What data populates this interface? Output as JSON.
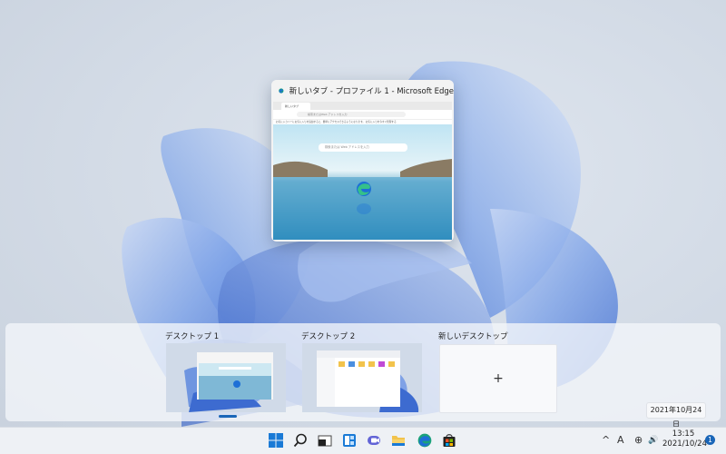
{
  "window": {
    "title": "新しいタブ - プロファイル 1 - Microsoft Edge",
    "tab_label": "新しいタブ",
    "address_placeholder": "検索またはWeb アドレスを入力",
    "favorites_bar_text": "お気に入りバーにお気に入りを追加すると、簡単にアクセスできるようになります。 お気に入りを今すぐ管理する",
    "search_placeholder": "検索または Web アドレスを入力"
  },
  "task_view": {
    "desktops": [
      {
        "label": "デスクトップ 1",
        "active": true
      },
      {
        "label": "デスクトップ 2",
        "active": false
      }
    ],
    "new_desktop_label": "新しいデスクトップ",
    "new_desktop_plus": "+",
    "date_badge": "2021年10月24日"
  },
  "taskbar": {
    "icons": [
      "windows-start-icon",
      "search-icon",
      "task-view-icon",
      "widgets-icon",
      "teams-chat-icon",
      "file-explorer-icon",
      "edge-icon",
      "store-icon"
    ],
    "tray": {
      "chevron": "^",
      "ime": "A",
      "globe": "⊕",
      "volume": "🔊"
    },
    "time": "13:15",
    "date": "2021/10/24",
    "notification_count": "1"
  },
  "colors": {
    "accent": "#1a66b8",
    "bloom": "#4a78d6"
  }
}
